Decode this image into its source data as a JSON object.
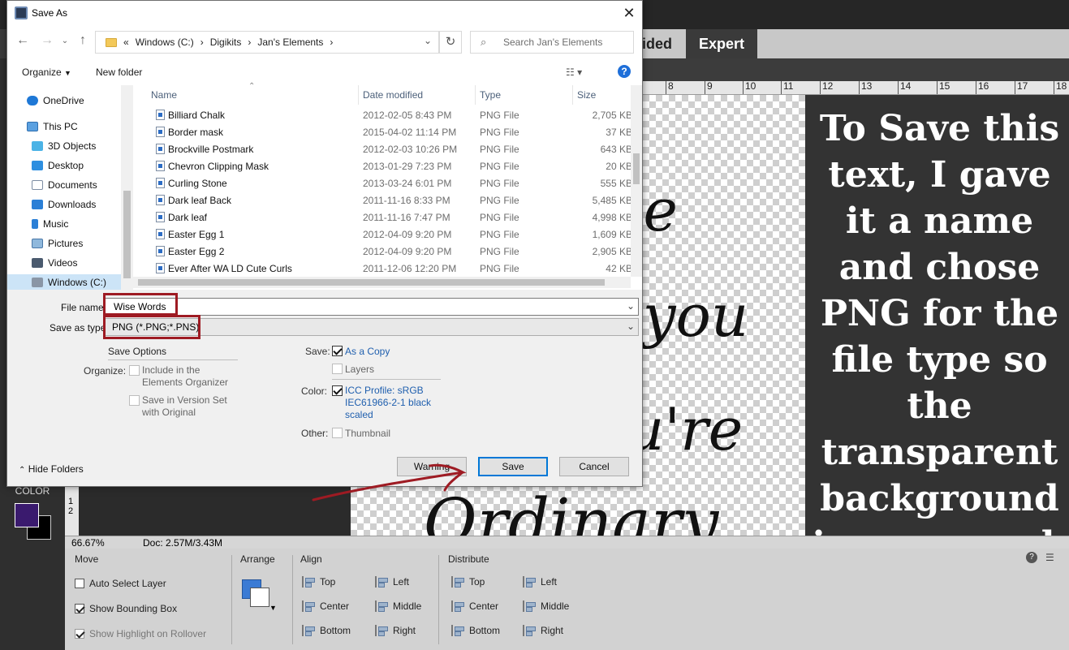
{
  "dialog": {
    "title": "Save As",
    "close": "✕",
    "nav": {
      "back": "←",
      "forward": "→",
      "up": "↑"
    },
    "address": {
      "prefix": "«",
      "parts": [
        "Windows (C:)",
        "Digikits",
        "Jan's Elements"
      ],
      "sep": "›"
    },
    "search_placeholder": "Search Jan's Elements",
    "toolbar": {
      "organize": "Organize",
      "new_folder": "New folder",
      "help": "?"
    },
    "sidebar": [
      {
        "label": "OneDrive"
      },
      {
        "label": "This PC"
      },
      {
        "label": "3D Objects"
      },
      {
        "label": "Desktop"
      },
      {
        "label": "Documents"
      },
      {
        "label": "Downloads"
      },
      {
        "label": "Music"
      },
      {
        "label": "Pictures"
      },
      {
        "label": "Videos"
      },
      {
        "label": "Windows (C:)"
      }
    ],
    "columns": {
      "name": "Name",
      "date": "Date modified",
      "type": "Type",
      "size": "Size"
    },
    "files": [
      {
        "name": "Billiard Chalk",
        "date": "2012-02-05 8:43 PM",
        "type": "PNG File",
        "size": "2,705 KB"
      },
      {
        "name": "Border mask",
        "date": "2015-04-02 11:14 PM",
        "type": "PNG File",
        "size": "37 KB"
      },
      {
        "name": "Brockville Postmark",
        "date": "2012-02-03 10:26 PM",
        "type": "PNG File",
        "size": "643 KB"
      },
      {
        "name": "Chevron Clipping Mask",
        "date": "2013-01-29 7:23 PM",
        "type": "PNG File",
        "size": "20 KB"
      },
      {
        "name": "Curling Stone",
        "date": "2013-03-24 6:01 PM",
        "type": "PNG File",
        "size": "555 KB"
      },
      {
        "name": "Dark leaf Back",
        "date": "2011-11-16 8:33 PM",
        "type": "PNG File",
        "size": "5,485 KB"
      },
      {
        "name": "Dark leaf",
        "date": "2011-11-16 7:47 PM",
        "type": "PNG File",
        "size": "4,998 KB"
      },
      {
        "name": "Easter Egg 1",
        "date": "2012-04-09 9:20 PM",
        "type": "PNG File",
        "size": "1,609 KB"
      },
      {
        "name": "Easter Egg 2",
        "date": "2012-04-09 9:20 PM",
        "type": "PNG File",
        "size": "2,905 KB"
      },
      {
        "name": "Ever After WA LD Cute Curls",
        "date": "2011-12-06 12:20 PM",
        "type": "PNG File",
        "size": "42 KB"
      }
    ],
    "file_name_label": "File name:",
    "file_name_value": "Wise Words",
    "save_type_label": "Save as type:",
    "save_type_value": "PNG (*.PNG;*.PNS)",
    "save_options": {
      "title": "Save Options",
      "organize_label": "Organize:",
      "include_organizer": "Include in the Elements Organizer",
      "save_version_set": "Save in Version Set with Original",
      "save_label": "Save:",
      "as_copy": "As a Copy",
      "layers": "Layers",
      "color_label": "Color:",
      "icc_profile": "ICC Profile:  sRGB IEC61966-2-1 black scaled",
      "other_label": "Other:",
      "thumbnail": "Thumbnail"
    },
    "buttons": {
      "warning": "Warning",
      "save": "Save",
      "cancel": "Cancel"
    },
    "hide_folders": "Hide Folders"
  },
  "app": {
    "modes": {
      "guided": "ided",
      "expert": "Expert"
    },
    "ruler_ticks": [
      "8",
      "9",
      "10",
      "11",
      "12",
      "13",
      "14",
      "15",
      "16",
      "17",
      "18"
    ],
    "left_ruler": [
      "1",
      "2"
    ],
    "color_label": "COLOR",
    "instruction": "To Save this text, I gave it a name and chose PNG for the file type so the transparent background is preserved.",
    "status": {
      "zoom": "66.67%",
      "doc": "Doc: 2.57M/3.43M"
    },
    "options": {
      "move": "Move",
      "arrange": "Arrange",
      "align": "Align",
      "distribute": "Distribute",
      "auto_select": "Auto Select Layer",
      "bounding_box": "Show Bounding Box",
      "highlight": "Show Highlight on Rollover",
      "align_items": [
        "Top",
        "Center",
        "Bottom",
        "Left",
        "Middle",
        "Right"
      ],
      "distribute_items": [
        "Top",
        "Center",
        "Bottom",
        "Left",
        "Middle",
        "Right"
      ]
    }
  },
  "colors": {
    "accent": "#0078d7",
    "annotation_red": "#9e1b23",
    "foreground": "#3a1a6e"
  }
}
